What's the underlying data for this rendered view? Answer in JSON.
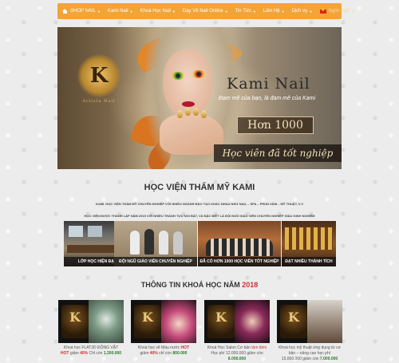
{
  "nav": {
    "items": [
      {
        "label": "SHOP NAIL",
        "home": true,
        "dropdown": true
      },
      {
        "label": "Kami Nail",
        "dropdown": true
      },
      {
        "label": "Khoá Học Nail",
        "dropdown": true
      },
      {
        "label": "Dạy Vẽ Nail Online",
        "dropdown": true
      },
      {
        "label": "Tin Tức",
        "dropdown": true
      },
      {
        "label": "Liên Hệ",
        "dropdown": true
      },
      {
        "label": "Dịch vụ",
        "dropdown": true
      }
    ],
    "language": "Ngôn ngữ",
    "bg_color": "#f3a437"
  },
  "banner": {
    "logo_mark": "K",
    "logo_sub": "Artista Nail",
    "title": "Kami Nail",
    "slogan": "Đam mê của bạn, là đam mê của Kami",
    "highlight": "Hơn 1000",
    "caption": "Học viên đã tốt nghiệp"
  },
  "intro": {
    "title": "HỌC VIỆN THẨM MỸ KAMI",
    "line1": "KAMI. HỌC VIỆN THẨM MỸ CHUYÊN NGHIỆP VỚI NHIỀU NGÀNH ĐÀO TẠO KHÁC NHAU NHƯ NAIL – SPA – PHUN XĂM – MỸ THUẬT, V.V",
    "line2": "HỌC VIỆN ĐƯỢC THÀNH LẬP NĂM 2015 VỚI NHIỀU THÀNH TỰU NỔI BẬT, VÀ ĐẶC BIỆT LÀ ĐỘI NGŨ GIÁO VIÊN CHUYÊN NGHIỆP GIÀU KINH NGHIỆM"
  },
  "features": [
    {
      "caption": "LỚP HỌC HIỆN ĐẠI"
    },
    {
      "caption": "ĐỘI NGŨ GIÁO VIÊN CHUYÊN NGHIỆP"
    },
    {
      "caption": "ĐÃ CÓ HƠN 1000 HỌC VIÊN TỐT NGHIỆP"
    },
    {
      "caption": "ĐẠT NHIỀU THÀNH TÍCH"
    }
  ],
  "courses_section": {
    "title": "THÔNG TIN KHOÁ HỌC NĂM",
    "year": "2018"
  },
  "courses": [
    {
      "line1": "Khoá học FLAT3D ĐỘNG VẬT",
      "hot": "HOT",
      "line2": "giảm",
      "discount": "40%",
      "line3": "Chỉ còn",
      "price": "1.200.000"
    },
    {
      "line1": "Khoá học vẽ Màu nước",
      "hot": "HOT",
      "line2": "giảm",
      "discount": "40%",
      "line3": "chỉ còn",
      "price": "800.000"
    },
    {
      "line1": "Khoá Học Salon Cơ bản",
      "hot": "làm tiệm",
      "line2": "Học phí 12.000.000 giảm còn",
      "discount": "",
      "line3": "",
      "price": "8.000.000"
    },
    {
      "line1": "Khoá học mỹ thuật ứng dụng từ cơ bản – nâng cao học phí",
      "hot": "",
      "line2": "15.000.000 giảm còn",
      "discount": "",
      "line3": "",
      "price": "7.000.000"
    }
  ]
}
